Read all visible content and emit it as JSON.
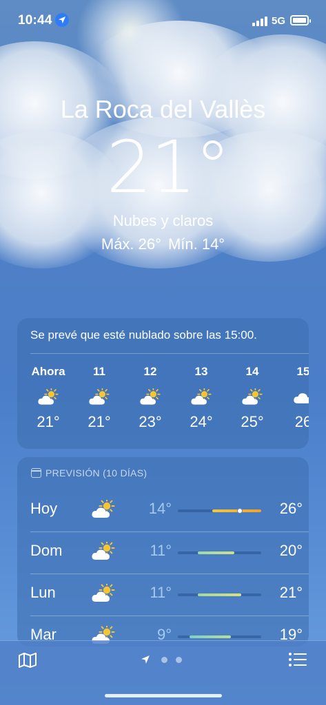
{
  "status_bar": {
    "time": "10:44",
    "network": "5G"
  },
  "location": {
    "city": "La Roca del Vallès",
    "temperature": "21°",
    "condition": "Nubes y claros",
    "high": "Máx. 26°",
    "low": "Mín. 14°"
  },
  "hourly": {
    "summary": "Se prevé que esté nublado sobre las 15:00.",
    "items": [
      {
        "label": "Ahora",
        "icon": "partly-sunny-icon",
        "temp": "21°"
      },
      {
        "label": "11",
        "icon": "partly-sunny-icon",
        "temp": "21°"
      },
      {
        "label": "12",
        "icon": "partly-sunny-icon",
        "temp": "23°"
      },
      {
        "label": "13",
        "icon": "partly-sunny-icon",
        "temp": "24°"
      },
      {
        "label": "14",
        "icon": "partly-sunny-icon",
        "temp": "25°"
      },
      {
        "label": "15",
        "icon": "cloud-icon",
        "temp": "26"
      }
    ]
  },
  "daily": {
    "header": "PREVISIÓN (10 DÍAS)",
    "items": [
      {
        "day": "Hoy",
        "icon": "partly-sunny-icon",
        "low": "14°",
        "high": "26°",
        "range_start": 0.41,
        "range_end": 1.0,
        "current": 0.74,
        "colors": [
          "#f3c93a",
          "#f3a02b"
        ]
      },
      {
        "day": "Dom",
        "icon": "partly-sunny-icon",
        "low": "11°",
        "high": "20°",
        "range_start": 0.24,
        "range_end": 0.68,
        "colors": [
          "#9ed9a6",
          "#cfe08a"
        ]
      },
      {
        "day": "Lun",
        "icon": "partly-sunny-icon",
        "low": "11°",
        "high": "21°",
        "range_start": 0.24,
        "range_end": 0.76,
        "colors": [
          "#9ed9a6",
          "#d9e07e"
        ]
      },
      {
        "day": "Mar",
        "icon": "partly-sunny-icon",
        "low": "9°",
        "high": "19°",
        "range_start": 0.14,
        "range_end": 0.64,
        "colors": [
          "#7fd0c8",
          "#b9de95"
        ]
      }
    ]
  },
  "toolbar": {
    "map_icon": "map-icon",
    "list_icon": "list-icon",
    "page_count": 3,
    "active_page": 0
  }
}
